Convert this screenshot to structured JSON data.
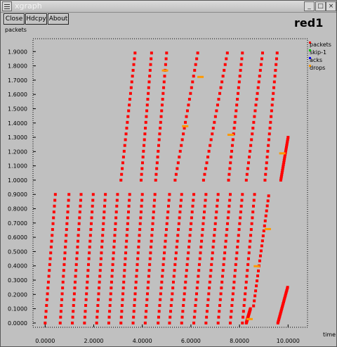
{
  "window": {
    "title": "xgraph",
    "min_glyph": "_",
    "max_glyph": "□",
    "close_glyph": "×"
  },
  "toolbar": {
    "close_label": "Close",
    "hdcpy_label": "Hdcpy",
    "about_label": "About"
  },
  "chart_data": {
    "type": "scatter",
    "title": "red1",
    "ylabel": "packets",
    "xlabel": "time",
    "xlim": [
      -0.5,
      10.8
    ],
    "ylim": [
      -0.03,
      1.99
    ],
    "x_ticks": [
      "0.0000",
      "2.0000",
      "4.0000",
      "6.0000",
      "8.0000",
      "10.0000"
    ],
    "x_tick_values": [
      0,
      2,
      4,
      6,
      8,
      10
    ],
    "y_ticks": [
      "0.0000",
      "0.1000",
      "0.2000",
      "0.3000",
      "0.4000",
      "0.5000",
      "0.6000",
      "0.7000",
      "0.8000",
      "0.9000",
      "1.0000",
      "1.1000",
      "1.2000",
      "1.3000",
      "1.4000",
      "1.5000",
      "1.6000",
      "1.7000",
      "1.8000",
      "1.9000"
    ],
    "y_tick_values": [
      0,
      0.1,
      0.2,
      0.3,
      0.4,
      0.5,
      0.6,
      0.7,
      0.8,
      0.9,
      1.0,
      1.1,
      1.2,
      1.3,
      1.4,
      1.5,
      1.6,
      1.7,
      1.8,
      1.9
    ],
    "grid": false,
    "legend_position": "right",
    "colors": {
      "packets": "#ff0000",
      "skip-1": "#00cc00",
      "acks": "#0000ff",
      "drops": "#ff9900",
      "background": "#c0c0c0",
      "frame": "#000000"
    },
    "series": [
      {
        "name": "packets",
        "color": "#ff0000",
        "segments": [
          {
            "x0": 0.0,
            "x1": 0.42,
            "y0": 0.0,
            "y1": 0.9
          },
          {
            "x0": 0.62,
            "x1": 0.98,
            "y0": 0.0,
            "y1": 0.9
          },
          {
            "x0": 1.12,
            "x1": 1.48,
            "y0": 0.0,
            "y1": 0.9
          },
          {
            "x0": 1.62,
            "x1": 1.98,
            "y0": 0.0,
            "y1": 0.9
          },
          {
            "x0": 2.12,
            "x1": 2.48,
            "y0": 0.0,
            "y1": 0.9
          },
          {
            "x0": 2.62,
            "x1": 2.98,
            "y0": 0.0,
            "y1": 0.9
          },
          {
            "x0": 3.12,
            "x1": 3.48,
            "y0": 0.0,
            "y1": 0.9
          },
          {
            "x0": 3.12,
            "x1": 3.7,
            "y0": 1.0,
            "y1": 1.89
          },
          {
            "x0": 3.62,
            "x1": 4.0,
            "y0": 0.0,
            "y1": 0.9
          },
          {
            "x0": 3.95,
            "x1": 4.38,
            "y0": 1.0,
            "y1": 1.89
          },
          {
            "x0": 4.12,
            "x1": 4.52,
            "y0": 0.0,
            "y1": 0.9
          },
          {
            "x0": 4.65,
            "x1": 5.12,
            "y0": 0.0,
            "y1": 0.9
          },
          {
            "x0": 4.55,
            "x1": 5.0,
            "y0": 1.0,
            "y1": 1.89
          },
          {
            "x0": 5.12,
            "x1": 5.62,
            "y0": 0.0,
            "y1": 0.9
          },
          {
            "x0": 5.35,
            "x1": 6.28,
            "y0": 1.0,
            "y1": 1.89
          },
          {
            "x0": 5.62,
            "x1": 6.12,
            "y0": 0.0,
            "y1": 0.9
          },
          {
            "x0": 6.12,
            "x1": 6.62,
            "y0": 0.0,
            "y1": 0.9
          },
          {
            "x0": 6.52,
            "x1": 7.5,
            "y0": 1.0,
            "y1": 1.89
          },
          {
            "x0": 6.62,
            "x1": 7.12,
            "y0": 0.0,
            "y1": 0.9
          },
          {
            "x0": 7.12,
            "x1": 7.62,
            "y0": 0.0,
            "y1": 0.9
          },
          {
            "x0": 7.62,
            "x1": 8.12,
            "y0": 0.0,
            "y1": 0.9
          },
          {
            "x0": 7.55,
            "x1": 8.12,
            "y0": 1.0,
            "y1": 1.89
          },
          {
            "x0": 8.12,
            "x1": 8.62,
            "y0": 0.0,
            "y1": 0.9
          },
          {
            "x0": 8.28,
            "x1": 8.95,
            "y0": 1.0,
            "y1": 1.89
          },
          {
            "x0": 8.28,
            "x1": 8.45,
            "y0": 0.0,
            "y1": 0.1
          },
          {
            "x0": 8.58,
            "x1": 9.2,
            "y0": 0.12,
            "y1": 0.89
          },
          {
            "x0": 9.05,
            "x1": 9.55,
            "y0": 1.0,
            "y1": 1.89
          },
          {
            "x0": 9.58,
            "x1": 9.98,
            "y0": 0.0,
            "y1": 0.25
          },
          {
            "x0": 9.7,
            "x1": 10.0,
            "y0": 1.0,
            "y1": 1.3
          }
        ]
      },
      {
        "name": "skip-1",
        "color": "#00cc00",
        "points": []
      },
      {
        "name": "acks",
        "color": "#0000ff",
        "points": []
      },
      {
        "name": "drops",
        "color": "#ff9900",
        "points": [
          {
            "x": 4.92,
            "y": 1.77
          },
          {
            "x": 6.38,
            "y": 1.725
          },
          {
            "x": 5.75,
            "y": 1.38
          },
          {
            "x": 7.62,
            "y": 1.32
          },
          {
            "x": 9.75,
            "y": 1.19
          },
          {
            "x": 8.4,
            "y": 0.03
          },
          {
            "x": 9.15,
            "y": 0.66
          },
          {
            "x": 8.7,
            "y": 0.4
          }
        ]
      }
    ]
  }
}
